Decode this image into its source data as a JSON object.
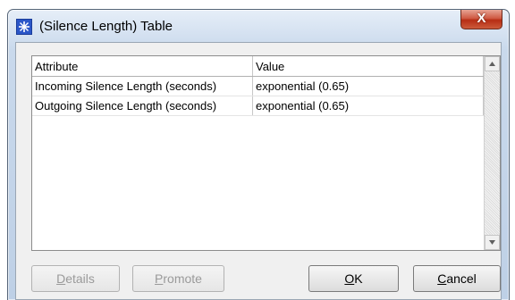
{
  "window": {
    "title": "(Silence Length) Table",
    "close_label": "X"
  },
  "table": {
    "columns": [
      "Attribute",
      "Value"
    ],
    "rows": [
      {
        "attribute": "Incoming Silence Length (seconds)",
        "value": "exponential (0.65)"
      },
      {
        "attribute": "Outgoing Silence Length (seconds)",
        "value": "exponential (0.65)"
      }
    ]
  },
  "buttons": {
    "details": {
      "label": "Details",
      "mnemonic": "D",
      "rest": "etails",
      "enabled": false
    },
    "promote": {
      "label": "Promote",
      "mnemonic": "P",
      "rest": "romote",
      "enabled": false
    },
    "ok": {
      "label": "OK",
      "mnemonic": "O",
      "rest": "K",
      "enabled": true
    },
    "cancel": {
      "label": "Cancel",
      "mnemonic": "C",
      "rest": "ancel",
      "enabled": true
    }
  },
  "colors": {
    "title_icon": "#2b56c8",
    "close_button": "#c6412a"
  }
}
